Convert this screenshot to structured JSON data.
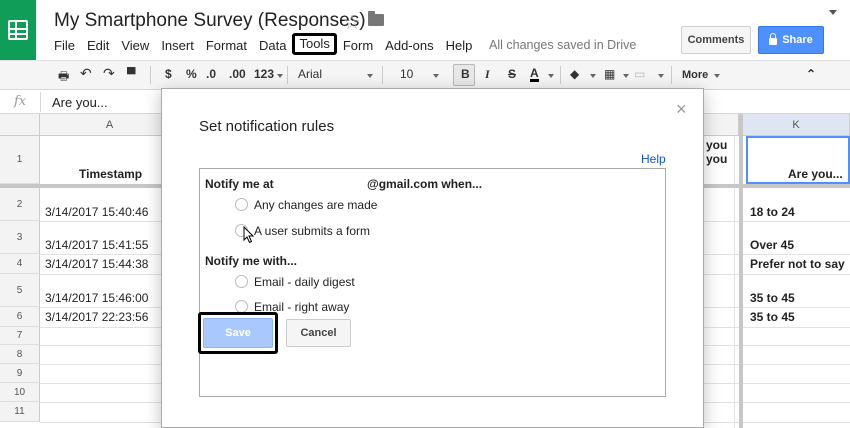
{
  "app": {
    "doc_title": "My Smartphone Survey (Responses)",
    "saved_status": "All changes saved in Drive",
    "comments_label": "Comments",
    "share_label": "Share"
  },
  "menu": [
    {
      "label": "File"
    },
    {
      "label": "Edit"
    },
    {
      "label": "View"
    },
    {
      "label": "Insert"
    },
    {
      "label": "Format"
    },
    {
      "label": "Data"
    },
    {
      "label": "Tools",
      "highlighted": true
    },
    {
      "label": "Form"
    },
    {
      "label": "Add-ons"
    },
    {
      "label": "Help"
    }
  ],
  "toolbar": {
    "currency": "$",
    "percent": "%",
    "dec_less": ".0",
    "dec_more": ".00",
    "number_format": "123",
    "font": "Arial",
    "font_size": "10",
    "bold": "B",
    "italic": "I",
    "strike": "S",
    "text_color": "A",
    "more": "More"
  },
  "formula_bar": {
    "fx": "fx",
    "content": "Are you..."
  },
  "columns": [
    {
      "label": "A"
    },
    {
      "label": "K"
    }
  ],
  "rows": [
    "1",
    "2",
    "3",
    "4",
    "5",
    "6",
    "7",
    "8",
    "9",
    "10",
    "11"
  ],
  "cells": {
    "a1": "Timestamp",
    "a2": "3/14/2017 15:40:46",
    "a3": "3/14/2017 15:41:55",
    "a4": "3/14/2017 15:44:38",
    "a5": "3/14/2017 15:46:00",
    "a6": "3/14/2017 22:23:56",
    "j1_line1": "you",
    "j1_line2": "you",
    "k1": "Are you...",
    "k2": "18 to 24",
    "k3": "Over 45",
    "k4": "Prefer not to say",
    "k5": "35 to 45",
    "k6": "35 to 45"
  },
  "dialog": {
    "title": "Set notification rules",
    "close": "×",
    "help": "Help",
    "notify_at_label": "Notify me at",
    "notify_at_email": "@gmail.com when...",
    "option_any_changes": "Any changes are made",
    "option_form_submit": "A user submits a form",
    "notify_with_label": "Notify me with...",
    "option_daily_digest": "Email - daily digest",
    "option_right_away": "Email - right away",
    "save_label": "Save",
    "cancel_label": "Cancel"
  },
  "colors": {
    "brand_green": "#0f9d58",
    "share_blue": "#4d90fe",
    "save_disabled_blue": "#a9c8fb",
    "help_link": "#1155cc"
  }
}
